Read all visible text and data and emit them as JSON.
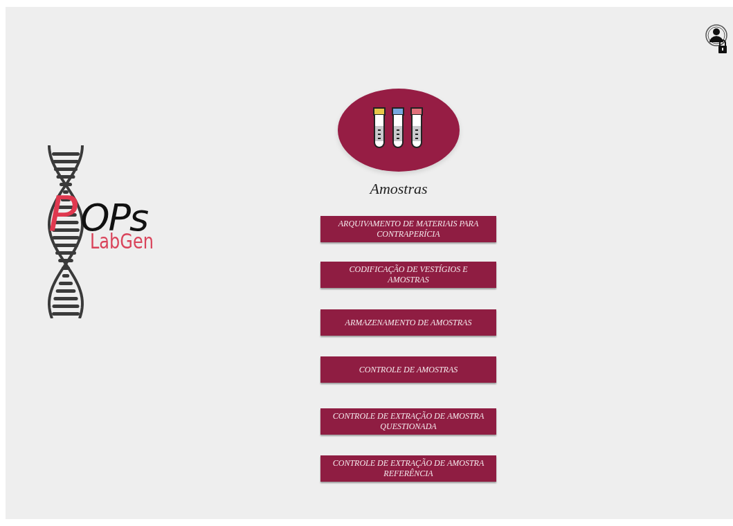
{
  "logo": {
    "initial": "P",
    "rest": "OPs",
    "subtitle": "LabGen"
  },
  "section": {
    "title": "Amostras"
  },
  "buttons": [
    {
      "label": "ARQUIVAMENTO DE MATERIAIS PARA CONTRAPERÍCIA"
    },
    {
      "label": "CODIFICAÇÃO DE VESTÍGIOS E AMOSTRAS"
    },
    {
      "label": "ARMAZENAMENTO DE AMOSTRAS"
    },
    {
      "label": "CONTROLE DE AMOSTRAS"
    },
    {
      "label": "CONTROLE DE EXTRAÇÃO DE AMOSTRA QUESTIONADA"
    },
    {
      "label": "CONTROLE DE EXTRAÇÃO DE AMOSTRA REFERÊNCIA"
    }
  ]
}
